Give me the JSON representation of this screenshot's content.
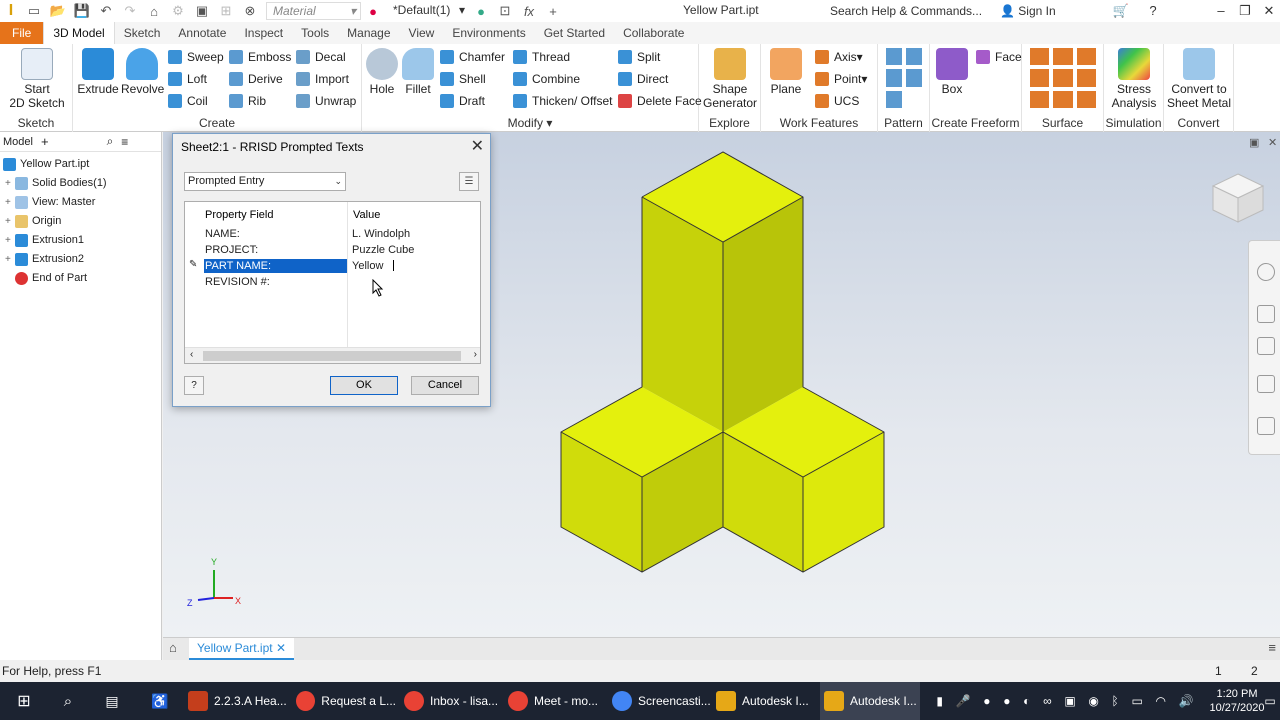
{
  "qat": {
    "material": "Material",
    "appearance": "*Default(1)",
    "title": "Yellow Part.ipt",
    "search_placeholder": "Search Help & Commands...",
    "signin": "Sign In"
  },
  "tabs": [
    "File",
    "3D Model",
    "Sketch",
    "Annotate",
    "Inspect",
    "Tools",
    "Manage",
    "View",
    "Environments",
    "Get Started",
    "Collaborate"
  ],
  "ribbon": {
    "sketch": {
      "label": "Sketch",
      "start": "Start",
      "start2": "2D Sketch"
    },
    "create": {
      "label": "Create",
      "extrude": "Extrude",
      "revolve": "Revolve",
      "sweep": "Sweep",
      "loft": "Loft",
      "coil": "Coil",
      "emboss": "Emboss",
      "derive": "Derive",
      "rib": "Rib",
      "decal": "Decal",
      "import": "Import",
      "unwrap": "Unwrap"
    },
    "modify": {
      "label": "Modify",
      "hole": "Hole",
      "fillet": "Fillet",
      "chamfer": "Chamfer",
      "shell": "Shell",
      "draft": "Draft",
      "thread": "Thread",
      "combine": "Combine",
      "thicken": "Thicken/ Offset",
      "split": "Split",
      "direct": "Direct",
      "delete_face": "Delete Face"
    },
    "explore": {
      "label": "Explore",
      "shape": "Shape",
      "generator": "Generator"
    },
    "work": {
      "label": "Work Features",
      "plane": "Plane",
      "axis": "Axis",
      "point": "Point",
      "ucs": "UCS"
    },
    "pattern": {
      "label": "Pattern"
    },
    "freeform": {
      "label": "Create Freeform",
      "box": "Box",
      "face": "Face"
    },
    "surface": {
      "label": "Surface"
    },
    "simulation": {
      "label": "Simulation",
      "stress": "Stress",
      "analysis": "Analysis"
    },
    "convert": {
      "label": "Convert",
      "convert_to": "Convert to",
      "sheet_metal": "Sheet Metal"
    }
  },
  "browser": {
    "title": "Model",
    "items": [
      "Yellow Part.ipt",
      "Solid Bodies(1)",
      "View: Master",
      "Origin",
      "Extrusion1",
      "Extrusion2",
      "End of Part"
    ]
  },
  "dialog": {
    "title": "Sheet2:1 - RRISD Prompted Texts",
    "combo": "Prompted Entry",
    "col_field": "Property Field",
    "col_value": "Value",
    "rows": [
      {
        "field": "NAME:",
        "value": "L. Windolph"
      },
      {
        "field": "PROJECT:",
        "value": "Puzzle Cube"
      },
      {
        "field": "PART NAME:",
        "value": "Yellow"
      },
      {
        "field": "REVISION #:",
        "value": ""
      }
    ],
    "ok": "OK",
    "cancel": "Cancel"
  },
  "doc_tab": "Yellow Part.ipt",
  "status": {
    "help": "For Help, press F1",
    "n1": "1",
    "n2": "2"
  },
  "taskbar": {
    "items": [
      "2.2.3.A Hea...",
      "Request a L...",
      "Inbox - lisa...",
      "Meet - mo...",
      "Screencasti...",
      "Autodesk I...",
      "Autodesk I..."
    ],
    "time": "1:20 PM",
    "date": "10/27/2020"
  },
  "colors": {
    "accent": "#e6731a",
    "model": "#e3f00b",
    "selection": "#0f63c8"
  }
}
